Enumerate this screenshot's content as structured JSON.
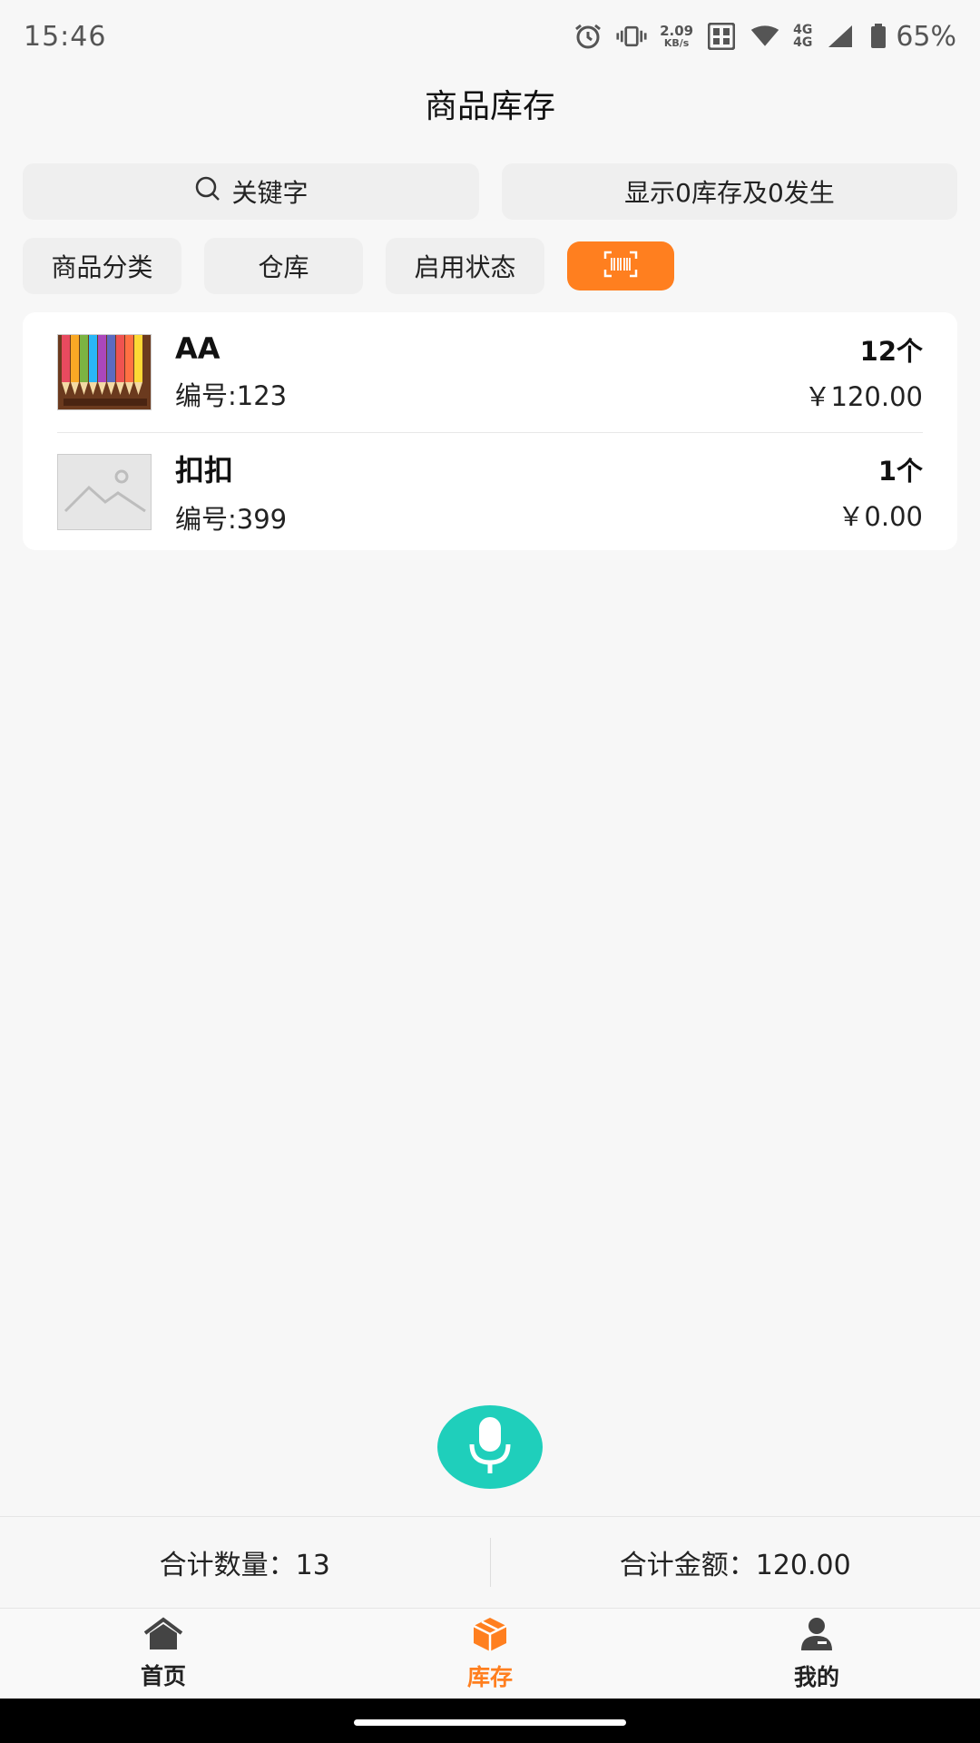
{
  "status_bar": {
    "time": "15:46",
    "net_speed_value": "2.09",
    "net_speed_unit": "KB/s",
    "network_top": "4G",
    "network_bottom": "4G",
    "battery": "65%",
    "icons": [
      "alarm-icon",
      "vibrate-icon",
      "sim-icon",
      "wifi-icon",
      "signal-icon",
      "battery-icon"
    ]
  },
  "header": {
    "title": "商品库存"
  },
  "filters": {
    "search_placeholder": "关键字",
    "zero_toggle": "显示0库存及0发生",
    "category": "商品分类",
    "warehouse": "仓库",
    "status": "启用状态",
    "scan_icon": "barcode-scan-icon"
  },
  "items": [
    {
      "name": "AA",
      "code": "编号:123",
      "qty": "12个",
      "price": "￥120.00",
      "thumb": "pencils-photo"
    },
    {
      "name": "扣扣",
      "code": "编号:399",
      "qty": "1个",
      "price": "￥0.00",
      "thumb": "image-placeholder-icon"
    }
  ],
  "totals": {
    "quantity": "合计数量：13",
    "amount": "合计金额：120.00"
  },
  "nav": {
    "home": "首页",
    "inventory": "库存",
    "mine": "我的"
  },
  "colors": {
    "accent": "#ff7f1f",
    "mic": "#1fcfbb",
    "background": "#f7f7f7"
  }
}
